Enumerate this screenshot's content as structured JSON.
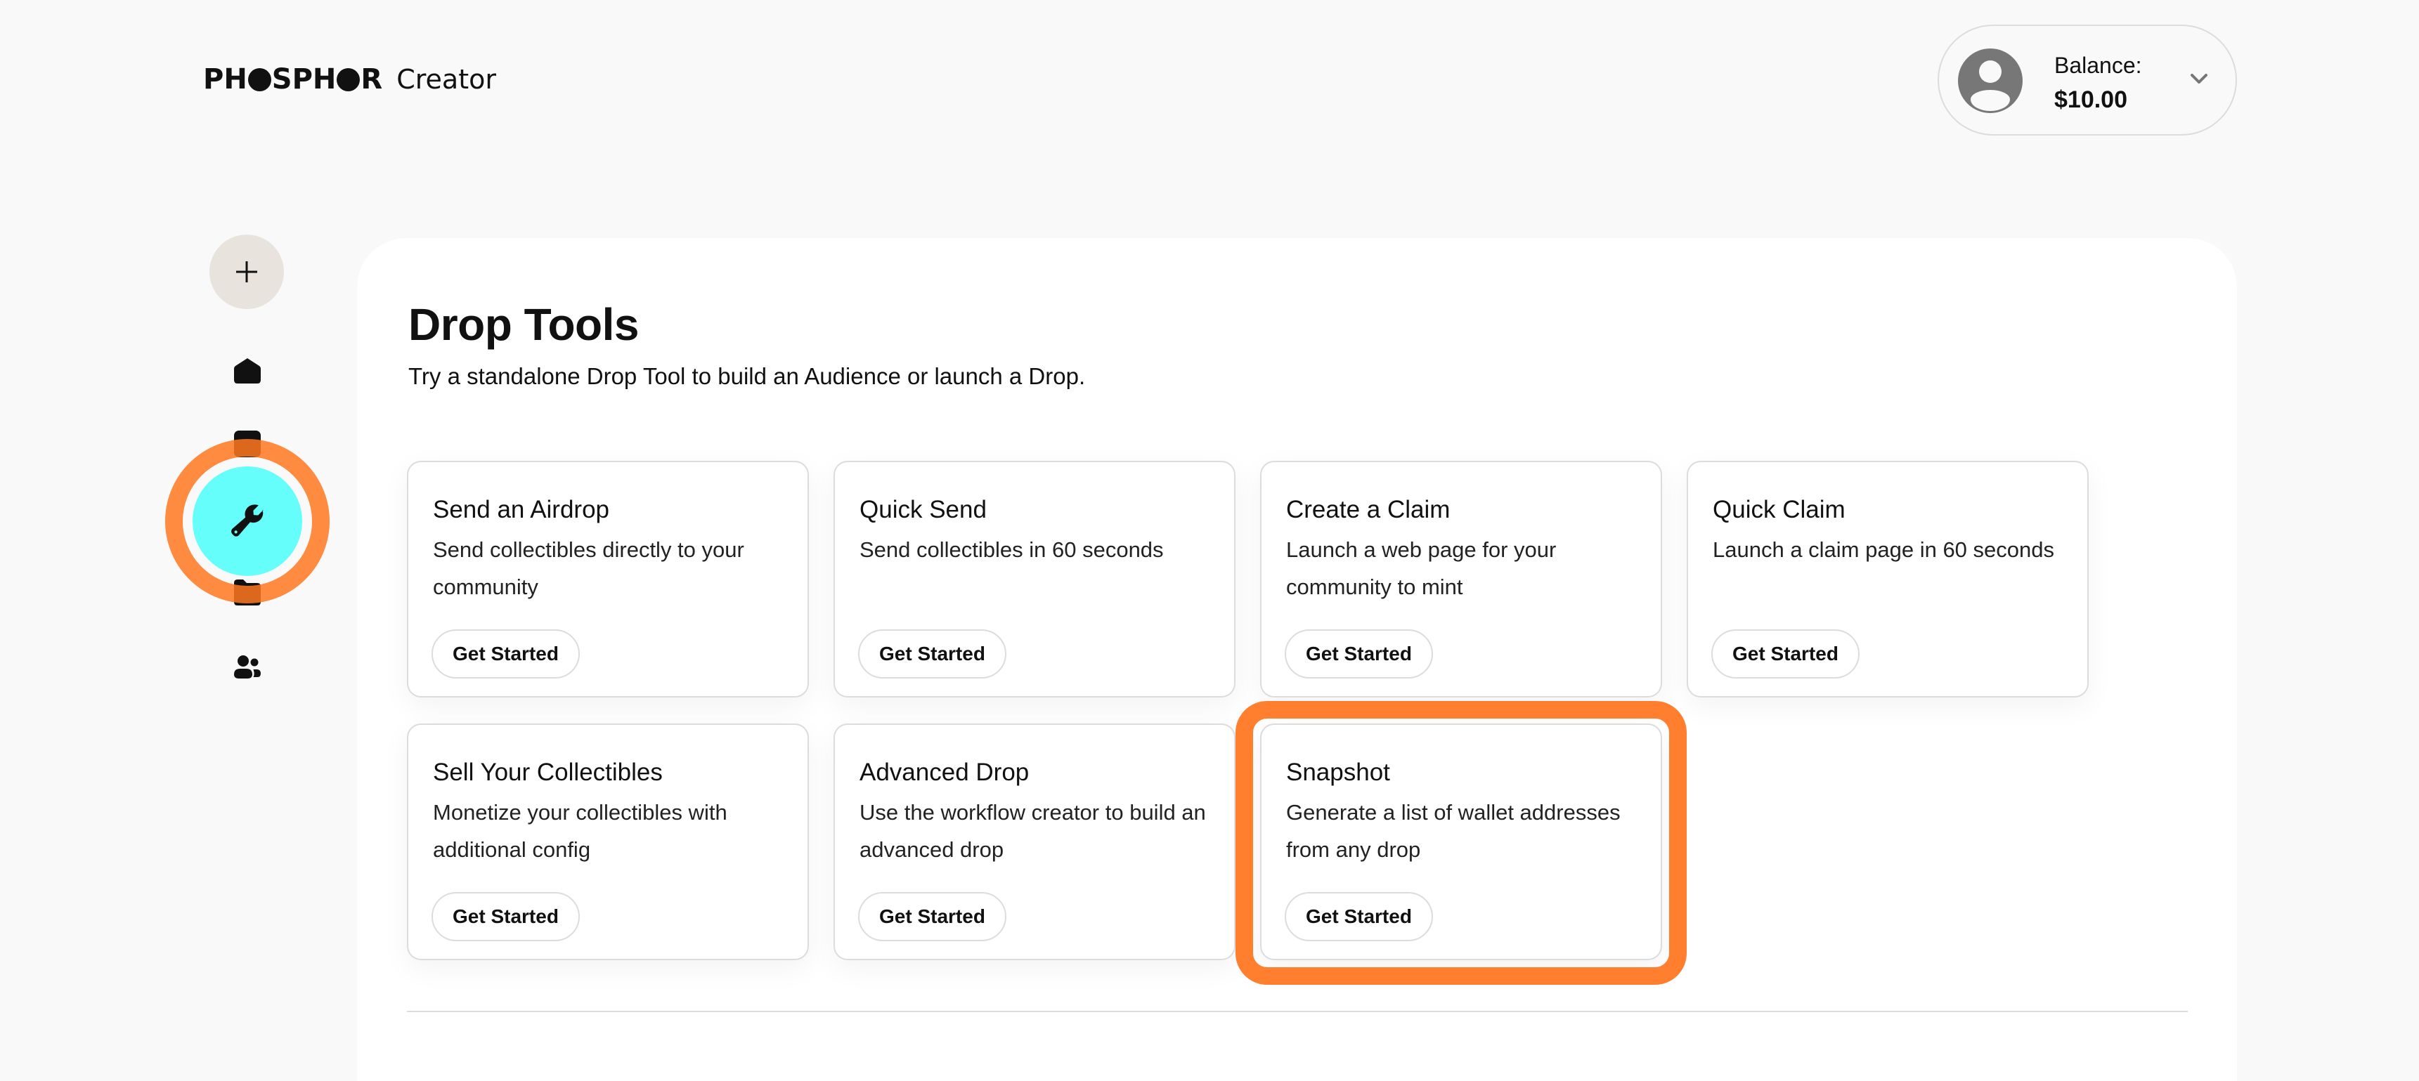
{
  "header": {
    "brand": [
      "PH",
      "SPH",
      "R"
    ],
    "product": "Creator",
    "balance_label": "Balance:",
    "balance_value": "$10.00"
  },
  "sidebar": {
    "items": [
      {
        "name": "add",
        "icon": "plus-icon"
      },
      {
        "name": "home",
        "icon": "home-icon"
      },
      {
        "name": "drafts",
        "icon": "drafts-icon"
      },
      {
        "name": "drop-tools",
        "icon": "wrench-icon",
        "active": true
      },
      {
        "name": "folder",
        "icon": "folder-icon"
      },
      {
        "name": "audience",
        "icon": "people-icon"
      }
    ]
  },
  "main": {
    "title": "Drop Tools",
    "subtitle": "Try a standalone Drop Tool to build an Audience or launch a Drop.",
    "tools": [
      {
        "title": "Send an Airdrop",
        "description": "Send collectibles directly to your community",
        "button": "Get Started"
      },
      {
        "title": "Quick Send",
        "description": "Send collectibles in 60 seconds",
        "button": "Get Started"
      },
      {
        "title": "Create a Claim",
        "description": "Launch a web page for your community to mint",
        "button": "Get Started"
      },
      {
        "title": "Quick Claim",
        "description": "Launch a claim page in 60 seconds",
        "button": "Get Started"
      },
      {
        "title": "Sell Your Collectibles",
        "description": "Monetize your collectibles with additional config",
        "button": "Get Started"
      },
      {
        "title": "Advanced Drop",
        "description": "Use the workflow creator to build an advanced drop",
        "button": "Get Started"
      },
      {
        "title": "Snapshot",
        "description": "Generate a list of wallet addresses from any drop",
        "button": "Get Started",
        "highlighted": true
      }
    ]
  },
  "colors": {
    "accent_active": "#66fefa",
    "highlight": "#ff7f2f",
    "add_button_bg": "#e8e3dd"
  }
}
